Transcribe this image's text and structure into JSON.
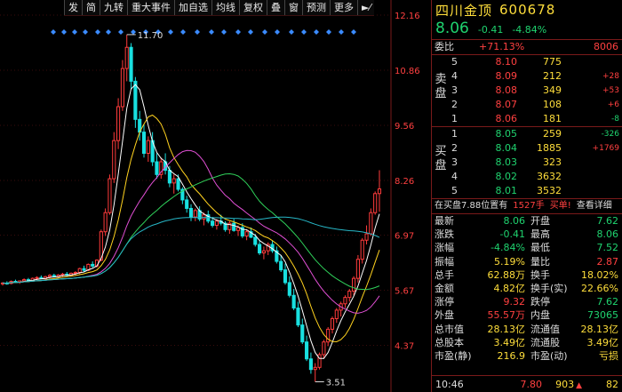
{
  "toolbar": {
    "buttons": [
      "发",
      "简",
      "九转",
      "重大事件",
      "加自选",
      "均线",
      "复权",
      "叠",
      "窗",
      "预测",
      "更多"
    ],
    "nav_icon": "step-arrow-icon"
  },
  "chart": {
    "price_ticks": [
      "12.16",
      "10.86",
      "9.56",
      "8.26",
      "6.97",
      "5.67",
      "4.37"
    ],
    "high_label": "11.70",
    "low_label": "3.51",
    "colors": {
      "up": "#ff3b3b",
      "down": "#19e0e0",
      "ma5": "#ffffff",
      "ma10": "#ffd21f",
      "ma20": "#e04fd4",
      "ma30": "#2fd15a",
      "ma60": "#27b7c7"
    }
  },
  "header": {
    "name": "四川金顶",
    "code": "600678",
    "price": "8.06",
    "change": "-0.41",
    "change_pct": "-4.84%"
  },
  "ratio": {
    "label": "委比",
    "pct": "+71.13%",
    "diff": "8006"
  },
  "sell_side_label": "卖盘",
  "buy_side_label": "买盘",
  "sell": [
    {
      "level": "5",
      "price": "8.10",
      "vol": "775",
      "chg": ""
    },
    {
      "level": "4",
      "price": "8.09",
      "vol": "212",
      "chg": "+28"
    },
    {
      "level": "3",
      "price": "8.08",
      "vol": "349",
      "chg": "+53"
    },
    {
      "level": "2",
      "price": "8.07",
      "vol": "108",
      "chg": "+6"
    },
    {
      "level": "1",
      "price": "8.06",
      "vol": "181",
      "chg": "-8"
    }
  ],
  "buy": [
    {
      "level": "1",
      "price": "8.05",
      "vol": "259",
      "chg": "-326"
    },
    {
      "level": "2",
      "price": "8.04",
      "vol": "1885",
      "chg": "+1769"
    },
    {
      "level": "3",
      "price": "8.03",
      "vol": "323",
      "chg": ""
    },
    {
      "level": "4",
      "price": "8.02",
      "vol": "3632",
      "chg": ""
    },
    {
      "level": "5",
      "price": "8.01",
      "vol": "3532",
      "chg": ""
    }
  ],
  "notice": {
    "text1": "在买盘7.88位置有",
    "amount": "1527手",
    "action": "买单!",
    "link": "查看详细"
  },
  "stats": [
    {
      "k1": "最新",
      "v1": "8.06",
      "c1": "green",
      "k2": "开盘",
      "v2": "7.62",
      "c2": "green"
    },
    {
      "k1": "涨跌",
      "v1": "-0.41",
      "c1": "green",
      "k2": "最高",
      "v2": "8.06",
      "c2": "green"
    },
    {
      "k1": "涨幅",
      "v1": "-4.84%",
      "c1": "green",
      "k2": "最低",
      "v2": "7.52",
      "c2": "green"
    },
    {
      "k1": "振幅",
      "v1": "5.19%",
      "c1": "yellow",
      "k2": "量比",
      "v2": "2.87",
      "c2": "red"
    },
    {
      "k1": "总手",
      "v1": "62.88万",
      "c1": "yellow",
      "k2": "换手",
      "v2": "18.02%",
      "c2": "yellow"
    },
    {
      "k1": "金额",
      "v1": "4.82亿",
      "c1": "yellow",
      "k2": "换手(实)",
      "v2": "22.66%",
      "c2": "yellow"
    },
    {
      "k1": "涨停",
      "v1": "9.32",
      "c1": "red",
      "k2": "跌停",
      "v2": "7.62",
      "c2": "green"
    },
    {
      "k1": "外盘",
      "v1": "55.57万",
      "c1": "red",
      "k2": "内盘",
      "v2": "73065",
      "c2": "green"
    },
    {
      "k1": "总市值",
      "v1": "28.13亿",
      "c1": "yellow",
      "k2": "流通值",
      "v2": "28.13亿",
      "c2": "yellow"
    },
    {
      "k1": "总股本",
      "v1": "3.49亿",
      "c1": "yellow",
      "k2": "流通股",
      "v2": "3.49亿",
      "c2": "yellow"
    },
    {
      "k1": "市盈(静)",
      "v1": "216.9",
      "c1": "yellow",
      "k2": "市盈(动)",
      "v2": "亏损",
      "c2": "yellow"
    }
  ],
  "tick": {
    "time": "10:46",
    "price": "7.80",
    "vol": "903",
    "vol2": "82"
  }
}
